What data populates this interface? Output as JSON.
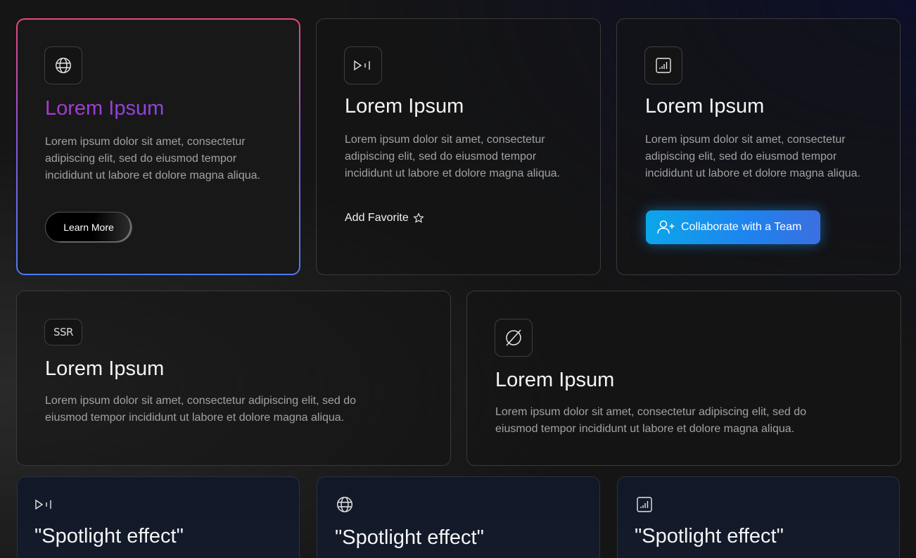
{
  "cards_row1": [
    {
      "icon": "globe-icon",
      "title": "Lorem Ipsum",
      "description": "Lorem ipsum dolor sit amet, consectetur adipiscing elit, sed do eiusmod tempor incididunt ut labore et dolore magna aliqua.",
      "button_label": "Learn More"
    },
    {
      "icon": "play-pause-icon",
      "title": "Lorem Ipsum",
      "description": "Lorem ipsum dolor sit amet, consectetur adipiscing elit, sed do eiusmod tempor incididunt ut labore et dolore magna aliqua.",
      "link_label": "Add Favorite",
      "link_icon": "star-icon"
    },
    {
      "icon": "signal-bars-icon",
      "title": "Lorem Ipsum",
      "description": "Lorem ipsum dolor sit amet, consectetur adipiscing elit, sed do eiusmod tempor incididunt ut labore et dolore magna aliqua.",
      "button_label": "Collaborate with a Team",
      "button_icon": "user-plus-icon"
    }
  ],
  "cards_row2": [
    {
      "icon_text": "SSR",
      "title": "Lorem Ipsum",
      "description": "Lorem ipsum dolor sit amet, consectetur adipiscing elit, sed do eiusmod tempor incididunt ut labore et dolore magna aliqua."
    },
    {
      "icon": "empty-set-icon",
      "title": "Lorem Ipsum",
      "description": "Lorem ipsum dolor sit amet, consectetur adipiscing elit, sed do eiusmod tempor incididunt ut labore et dolore magna aliqua."
    }
  ],
  "cards_row3": [
    {
      "icon": "play-pause-icon",
      "title": "\"Spotlight effect\""
    },
    {
      "icon": "globe-icon",
      "title": "\"Spotlight effect\""
    },
    {
      "icon": "signal-bars-icon",
      "title": "\"Spotlight effect\""
    }
  ],
  "colors": {
    "featured_title": "#a83ad0",
    "collab_button": "#1f82ee",
    "border_gradient_top": "#e8467f",
    "border_gradient_bottom": "#4a7cf0"
  }
}
